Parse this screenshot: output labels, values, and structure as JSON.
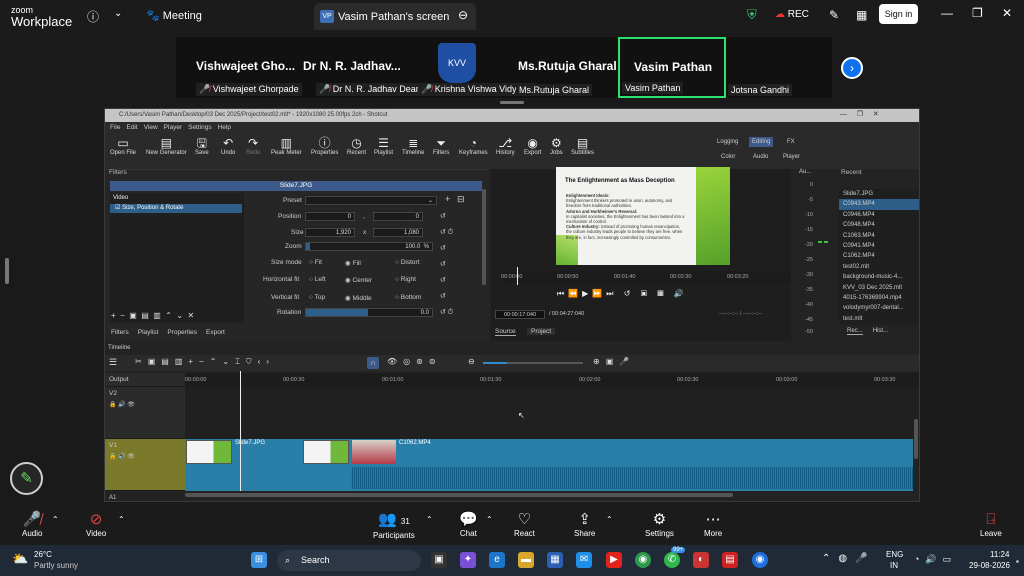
{
  "zoom": {
    "brand_top": "zoom",
    "brand_bottom": "Workplace",
    "meeting_label": "Meeting",
    "share_tab": {
      "avatar": "VP",
      "title": "Vasim Pathan's screen"
    },
    "rec_label": "REC",
    "signin_label": "Sign in",
    "participants": [
      {
        "name": "Vishwajeet  Gho...",
        "label": "Vishwajeet Ghorpade"
      },
      {
        "name": "Dr N. R. Jadhav...",
        "label": "Dr N. R. Jadhav DeanKIP"
      },
      {
        "name": "",
        "label": "Krishna Vishwa Vidyap..."
      },
      {
        "name": "Ms.Rutuja Gharal",
        "label": "Ms.Rutuja Gharal"
      },
      {
        "name": "Vasim Pathan",
        "label": "Vasim Pathan"
      },
      {
        "name": "",
        "label": "Jotsna Gandhi"
      }
    ],
    "footer": {
      "audio": "Audio",
      "video": "Video",
      "participants": "Participants",
      "participants_count": "31",
      "chat": "Chat",
      "react": "React",
      "share": "Share",
      "settings": "Settings",
      "more": "More",
      "leave": "Leave"
    }
  },
  "shotcut": {
    "window_title": "C:/Users/Vasim Pathan/Desktop/03 Dec 2025/Project/test02.mlt* - 1920x1080 25.00fps 2ch - Shotcut",
    "menu": [
      "File",
      "Edit",
      "View",
      "Player",
      "Settings",
      "Help"
    ],
    "toolbar": [
      "Open File",
      "New Generator",
      "Save",
      "Undo",
      "Redo",
      "Peak Meter",
      "Properties",
      "Recent",
      "Playlist",
      "Timeline",
      "Filters",
      "Keyframes",
      "History",
      "Export",
      "Jobs",
      "Subtitles"
    ],
    "layouts_top": [
      "Logging",
      "Editing",
      "FX"
    ],
    "layouts_bottom": [
      "Color",
      "Audio",
      "Player"
    ],
    "filters_label": "Filters",
    "filter_clip": "Slide7.JPG",
    "filter_group": "Video",
    "filter_item": "Size, Position & Rotate",
    "preset_label": "Preset",
    "position_label": "Position",
    "position_x": "0",
    "position_y": "0",
    "size_label": "Size",
    "size_w": "1,920",
    "size_h": "1,080",
    "zoom_label": "Zoom",
    "zoom_value": "100.0",
    "zoom_unit": "%",
    "size_mode_label": "Size mode",
    "size_mode_options": [
      "Fit",
      "Fill",
      "Distort"
    ],
    "hfit_label": "Horizontal fit",
    "hfit_options": [
      "Left",
      "Center",
      "Right"
    ],
    "vfit_label": "Vertical fit",
    "vfit_options": [
      "Top",
      "Middle",
      "Bottom"
    ],
    "rotation_label": "Rotation",
    "rotation_value": "0.0",
    "panel_tabs": [
      "Filters",
      "Playlist",
      "Properties",
      "Export"
    ],
    "preview": {
      "title": "The Enlightenment as Mass Deception",
      "b1": "Enlightenment Ideals:",
      "b1t": "Enlightenment thinkers promoted re ason, autonomy, and freedom from traditional authorities.",
      "b2": "Adorno and Horkheimer's Reversal:",
      "b2t": "In capitalist societies, the Enlightenment has been twisted into a mechanism of control.",
      "b3": "Culture Industry:",
      "b3t": "Instead of promoting human emancipation, the culture industry leads people to believe they are free, when they are, in fact, increasingly controlled by consumerism."
    },
    "player_ruler": [
      "00:00:00",
      "00:00:50",
      "00:01:40",
      "00:02:30",
      "00:03:20"
    ],
    "current_time": "00:00:17:040",
    "total_time": "/ 00:04:27:040",
    "inout": "--:--:--:-- / --:--:--:--",
    "source_tab": "Source",
    "project_tab": "Project",
    "audio_label": "Au...",
    "audio_scale": [
      "0",
      "-5",
      "-10",
      "-15",
      "-20",
      "-25",
      "-30",
      "-35",
      "-40",
      "-45",
      "-50"
    ],
    "recent_label": "Recent",
    "recent_items": [
      "Slide7.JPG",
      "C0943.MP4",
      "C0946.MP4",
      "C0948.MP4",
      "C1063.MP4",
      "C0941.MP4",
      "C1062.MP4",
      "test02.mlt",
      "background-music-4...",
      "KVV_03 Dec 2025.mlt",
      "4015-176369904.mp4",
      "volodymyr007-dental...",
      "test.mlt"
    ],
    "recent_tabs": [
      "Rec...",
      "Hist..."
    ],
    "timeline_label": "Timeline",
    "output_label": "Output",
    "tracks": [
      "V2",
      "V1",
      "A1"
    ],
    "tl_ruler": [
      "00:00:00",
      "00:00:30",
      "00:01:00",
      "00:01:30",
      "00:02:00",
      "00:02:30",
      "00:03:00",
      "00:03:30"
    ],
    "clip1": "Slide7.JPG",
    "clip2": "C1062.MP4"
  },
  "taskbar": {
    "temp": "26°C",
    "weather": "Partly sunny",
    "search": "Search",
    "lang_top": "ENG",
    "lang_bottom": "IN",
    "time": "11:24",
    "date": "29-08-2026",
    "badge": "99+"
  }
}
